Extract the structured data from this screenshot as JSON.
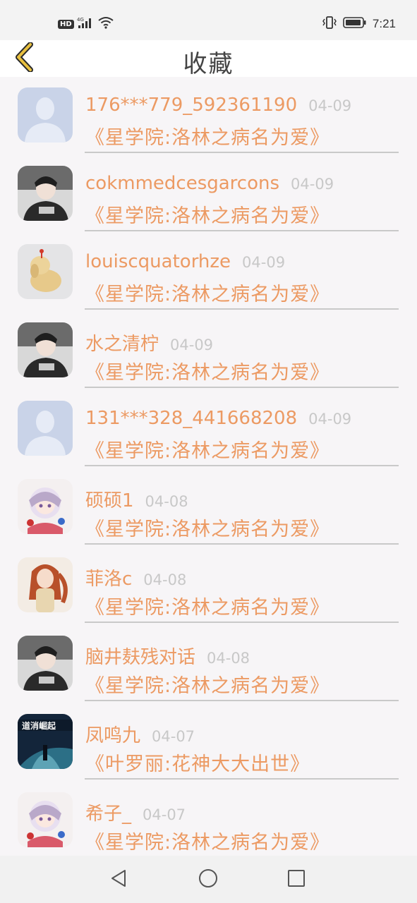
{
  "status_bar": {
    "hd": "HD",
    "network": "4G",
    "time": "7:21",
    "icons": [
      "signal-icon",
      "wifi-icon",
      "vibrate-icon",
      "battery-icon"
    ]
  },
  "header": {
    "title": "收藏",
    "back_icon": "chevron-left-icon",
    "accent_color": "#e8c040"
  },
  "colors": {
    "name_text": "#ec9a63",
    "date_text": "#c8c8c8",
    "divider": "#c9c9c9"
  },
  "items": [
    {
      "name": "176***779_592361190",
      "date": "04-09",
      "book": "《星学院:洛林之病名为爱》",
      "avatar": "default-avatar"
    },
    {
      "name": "cokmmedcesgarcons",
      "date": "04-09",
      "book": "《星学院:洛林之病名为爱》",
      "avatar": "user-photo-avatar"
    },
    {
      "name": "louiscquatorhze",
      "date": "04-09",
      "book": "《星学院:洛林之病名为爱》",
      "avatar": "figurine-avatar"
    },
    {
      "name": "水之清柠",
      "date": "04-09",
      "book": "《星学院:洛林之病名为爱》",
      "avatar": "user-photo-avatar"
    },
    {
      "name": "131***328_441668208",
      "date": "04-09",
      "book": "《星学院:洛林之病名为爱》",
      "avatar": "default-avatar"
    },
    {
      "name": "硕硕1",
      "date": "04-08",
      "book": "《星学院:洛林之病名为爱》",
      "avatar": "anime-avatar"
    },
    {
      "name": "菲洛c",
      "date": "04-08",
      "book": "《星学院:洛林之病名为爱》",
      "avatar": "doll-avatar"
    },
    {
      "name": "脑井麸残对话",
      "date": "04-08",
      "book": "《星学院:洛林之病名为爱》",
      "avatar": "user-photo-avatar"
    },
    {
      "name": "凤鸣九",
      "date": "04-07",
      "book": "《叶罗丽:花神大大出世》",
      "avatar": "game-poster-avatar"
    },
    {
      "name": "希子_",
      "date": "04-07",
      "book": "《星学院:洛林之病名为爱》",
      "avatar": "anime-avatar"
    }
  ],
  "nav_bar": {
    "icons": [
      "back-triangle-icon",
      "home-circle-icon",
      "recents-square-icon"
    ]
  }
}
